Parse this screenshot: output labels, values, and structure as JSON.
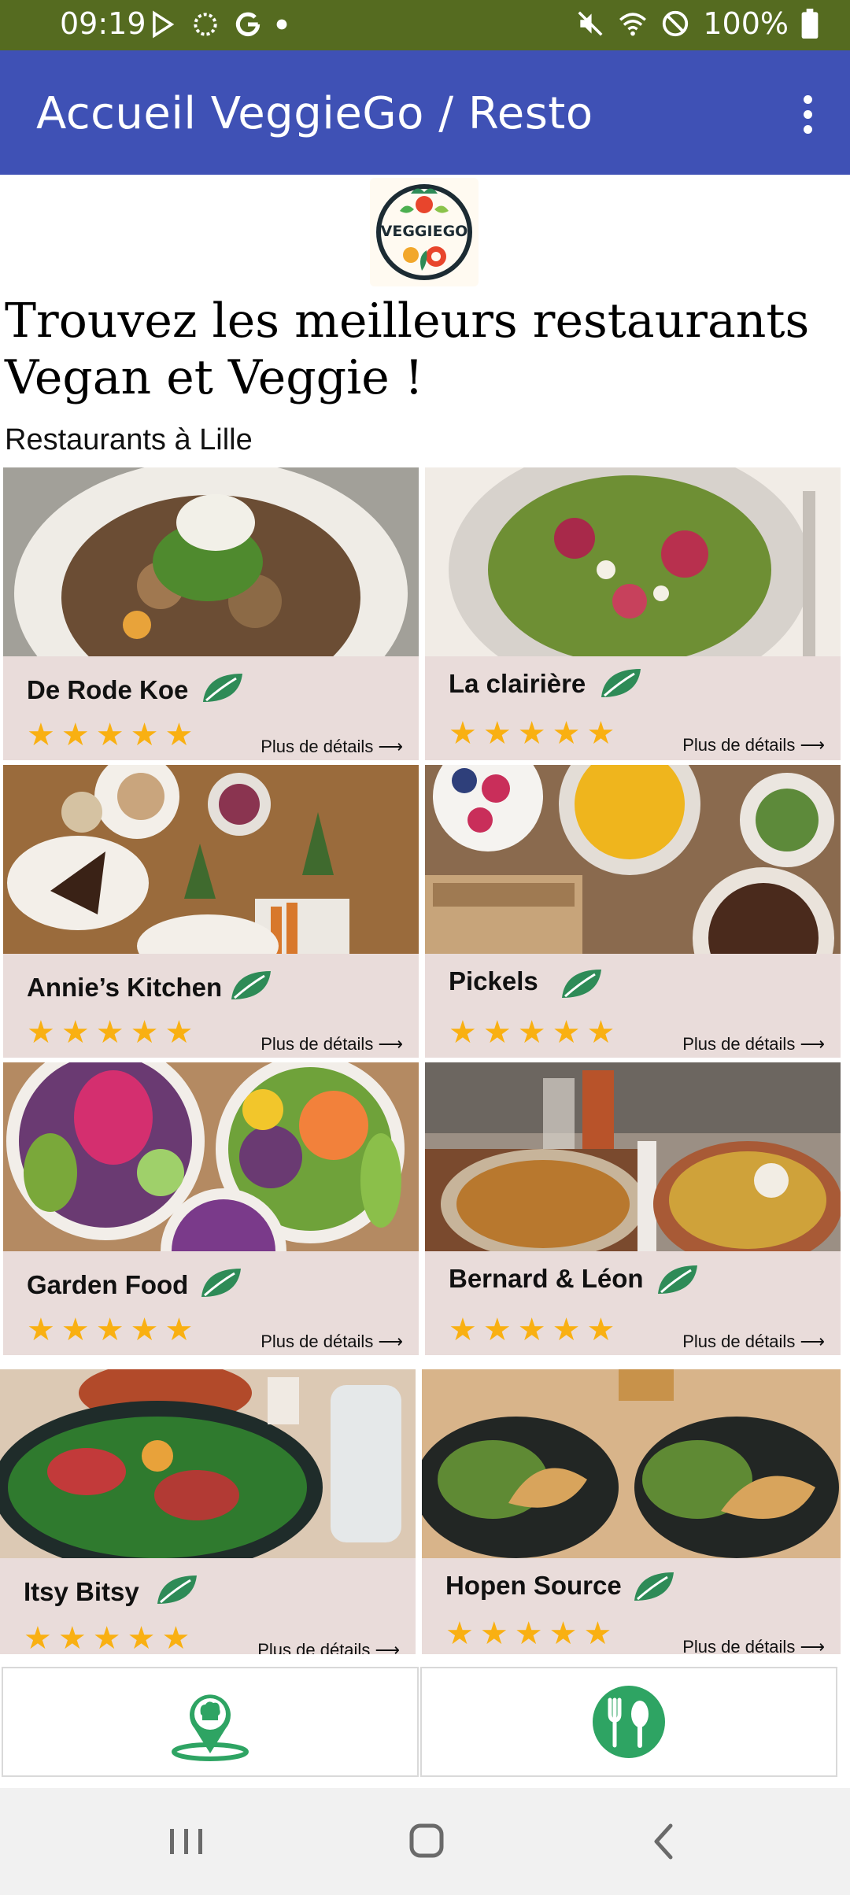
{
  "status_bar": {
    "time": "09:19",
    "battery": "100%",
    "left_icons": [
      "play-store-icon",
      "loading-icon",
      "google-icon",
      "dot-icon"
    ],
    "right_icons": [
      "mute-icon",
      "wifi-icon",
      "do-not-disturb-icon",
      "battery-icon"
    ]
  },
  "app_bar": {
    "title": "Accueil VeggieGo / Resto",
    "menu_icon": "more-vert-icon"
  },
  "logo": {
    "text": "VEGGIEGO"
  },
  "headline": "Trouvez les meilleurs restaurants Vegan et Veggie !",
  "subtitle": "Restaurants à Lille",
  "restaurants": [
    {
      "name": "De Rode Koe",
      "rating": 5,
      "details": "Plus de détails"
    },
    {
      "name": "La clairière",
      "rating": 5,
      "details": "Plus de détails"
    },
    {
      "name": "Annie’s Kitchen",
      "rating": 5,
      "details": "Plus de détails"
    },
    {
      "name": "Pickels",
      "rating": 5,
      "details": "Plus de détails"
    },
    {
      "name": "Garden Food",
      "rating": 5,
      "details": "Plus de détails"
    },
    {
      "name": "Bernard & Léon",
      "rating": 5,
      "details": "Plus de détails"
    },
    {
      "name": "Itsy Bitsy",
      "rating": 5,
      "details": "Plus de détails"
    },
    {
      "name": "Hopen Source",
      "rating": 5,
      "details": "Plus de détails"
    }
  ],
  "bottom_buttons": [
    {
      "icon": "chef-location-icon"
    },
    {
      "icon": "restaurant-cutlery-icon"
    }
  ],
  "nav": [
    "recents-icon",
    "home-icon",
    "back-icon"
  ],
  "colors": {
    "status_bar": "#556b20",
    "app_bar": "#3f51b5",
    "card_background": "#e9dcda",
    "star": "#f9b012",
    "leaf": "#2e8b57",
    "bottom_icon": "#2ea463"
  }
}
